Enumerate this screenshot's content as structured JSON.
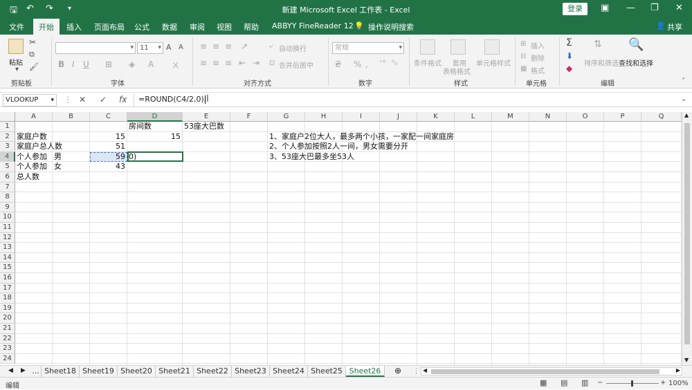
{
  "window": {
    "title": "新建 Microsoft Excel 工作表 - Excel",
    "login_label": "登录",
    "share_label": "共享"
  },
  "ribbon_tabs": [
    "文件",
    "开始",
    "插入",
    "页面布局",
    "公式",
    "数据",
    "审阅",
    "视图",
    "帮助",
    "ABBYY FineReader 12"
  ],
  "tell_me": "操作说明搜索",
  "ribbon": {
    "clipboard": {
      "label": "剪贴板",
      "paste": "粘贴"
    },
    "font": {
      "label": "字体",
      "size": "11",
      "bold": "B",
      "italic": "I",
      "underline": "U",
      "grow": "A",
      "shrink": "A",
      "color": "A"
    },
    "alignment": {
      "label": "对齐方式",
      "wrap": "自动换行",
      "merge": "合并后居中"
    },
    "number": {
      "label": "数字",
      "format": "常规",
      "percent": "%"
    },
    "styles": {
      "label": "样式",
      "cond": "条件格式",
      "table_l1": "套用",
      "table_l2": "表格格式",
      "cell": "单元格样式"
    },
    "cells": {
      "label": "单元格",
      "insert": "插入",
      "delete": "删除",
      "format": "格式"
    },
    "editing": {
      "label": "编辑",
      "sort": "排序和筛选",
      "find": "查找和选择"
    }
  },
  "formula_bar": {
    "name_box": "VLOOKUP",
    "cancel": "✕",
    "enter": "✓",
    "fx": "fx",
    "content": "=ROUND(C4/2,0)"
  },
  "columns": [
    "A",
    "B",
    "C",
    "D",
    "E",
    "F",
    "G",
    "H",
    "I",
    "J",
    "K",
    "L",
    "M",
    "N",
    "O",
    "P",
    "Q"
  ],
  "rows": [
    "1",
    "2",
    "3",
    "4",
    "5",
    "6",
    "7",
    "8",
    "9",
    "10",
    "11",
    "12",
    "13",
    "14",
    "15",
    "16",
    "17",
    "18",
    "19",
    "20",
    "21",
    "22",
    "23",
    "24"
  ],
  "cells": {
    "D1": "房间数",
    "E1": "53座大巴数",
    "A2": "家庭户数",
    "C2": "15",
    "D2": "15",
    "G2": "1、家庭户2位大人，最多两个小孩，一家配一间家庭房",
    "A3": "家庭户总人数",
    "C3": "51",
    "G3": "2、个人参加按照2人一间，男女需要分开",
    "A4": "个人参加",
    "B4": "男",
    "C4": "59",
    "D4": "0)",
    "G4": "3、53座大巴最多坐53人",
    "A5": "个人参加",
    "B5": "女",
    "C5": "43",
    "A6": "总人数"
  },
  "sheets": [
    "...",
    "Sheet18",
    "Sheet19",
    "Sheet20",
    "Sheet21",
    "Sheet22",
    "Sheet23",
    "Sheet24",
    "Sheet25",
    "Sheet26"
  ],
  "active_sheet": "Sheet26",
  "status": {
    "mode": "编辑",
    "zoom": "100%"
  },
  "colors": {
    "accent": "#217346",
    "selection": "#dbe6f3"
  }
}
